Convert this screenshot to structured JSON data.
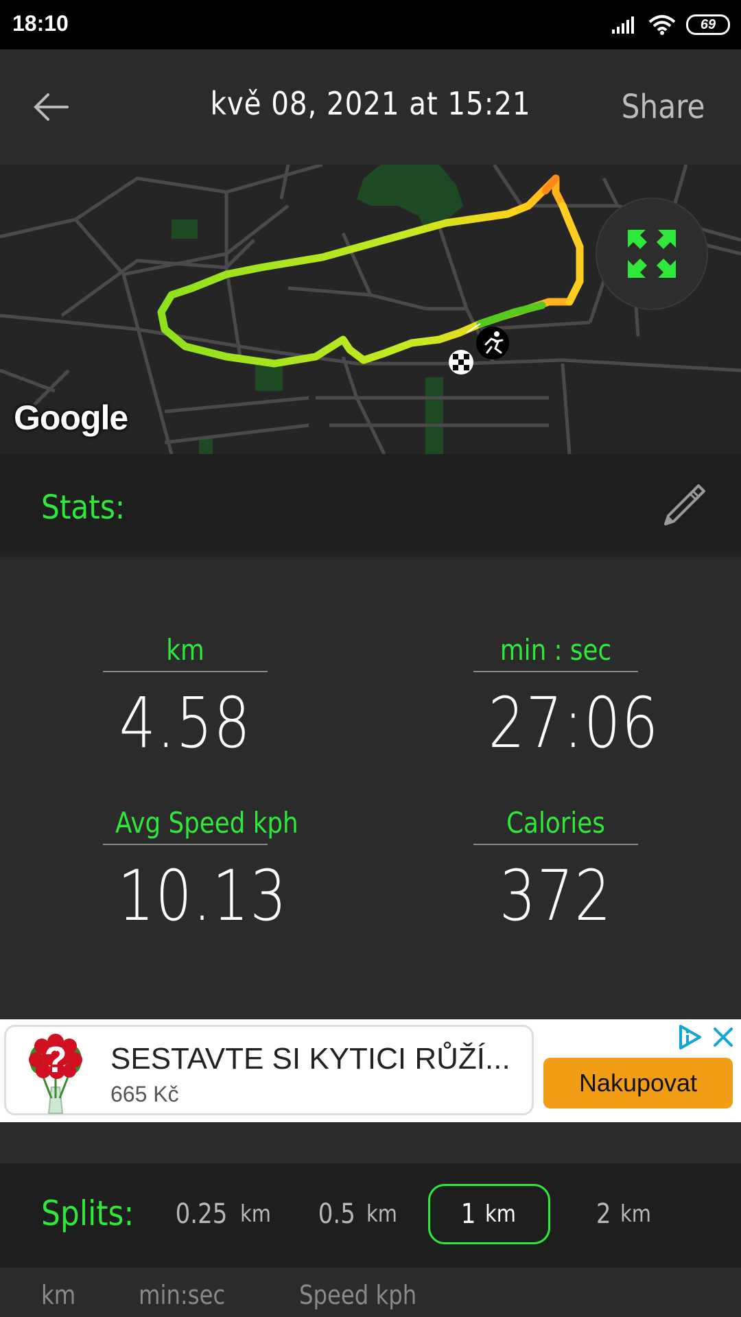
{
  "status_bar": {
    "time": "18:10",
    "battery": "69"
  },
  "header": {
    "title": "kvě 08, 2021 at 15:21",
    "share_label": "Share"
  },
  "map": {
    "attribution": "Google"
  },
  "stats": {
    "heading": "Stats:",
    "items": [
      {
        "label": "km",
        "value": "4.58"
      },
      {
        "label": "min : sec",
        "value": "27:06"
      },
      {
        "label": "Avg Speed kph",
        "value": "10.13"
      },
      {
        "label": "Calories",
        "value": "372"
      }
    ]
  },
  "ad": {
    "title": "SESTAVTE SI KYTICI RŮŽÍ...",
    "price": "665 Kč",
    "cta": "Nakupovat"
  },
  "splits": {
    "heading": "Splits:",
    "options": [
      {
        "value": "0.25",
        "unit": "km"
      },
      {
        "value": "0.5",
        "unit": "km"
      },
      {
        "value": "1",
        "unit": "km",
        "selected": true
      },
      {
        "value": "2",
        "unit": "km"
      }
    ],
    "columns": [
      "km",
      "min:sec",
      "Speed kph"
    ]
  },
  "colors": {
    "accent": "#2ee83a",
    "cta": "#f29d16",
    "background": "#2b2b2b"
  }
}
